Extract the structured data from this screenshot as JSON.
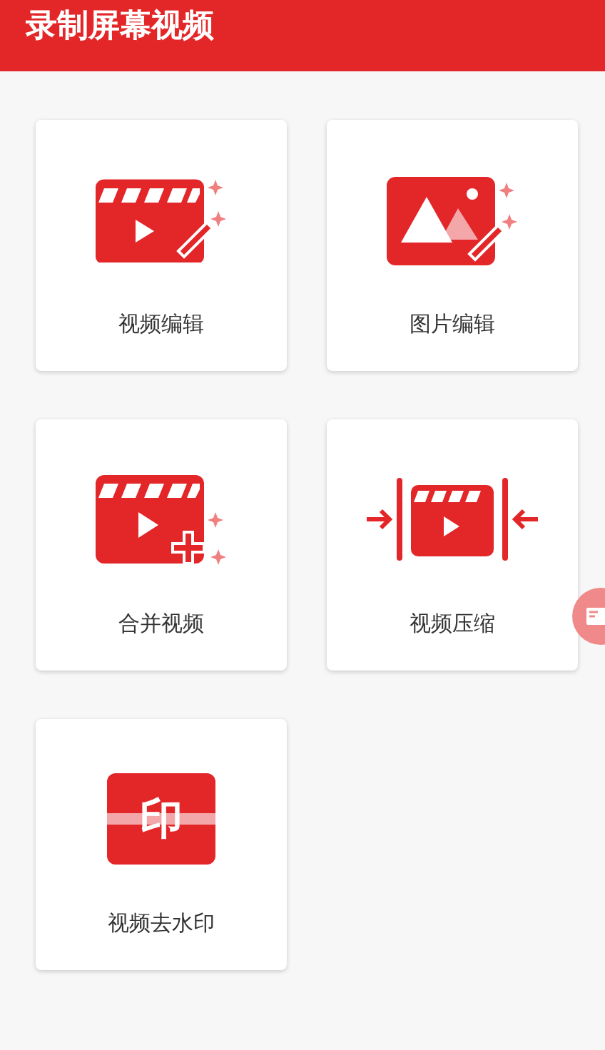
{
  "header": {
    "title": "录制屏幕视频"
  },
  "tools": [
    {
      "kind": "video-edit",
      "label": "视频编辑"
    },
    {
      "kind": "image-edit",
      "label": "图片编辑"
    },
    {
      "kind": "video-merge",
      "label": "合并视频"
    },
    {
      "kind": "video-compress",
      "label": "视频压缩"
    },
    {
      "kind": "watermark",
      "label": "视频去水印",
      "glyph": "印"
    }
  ]
}
